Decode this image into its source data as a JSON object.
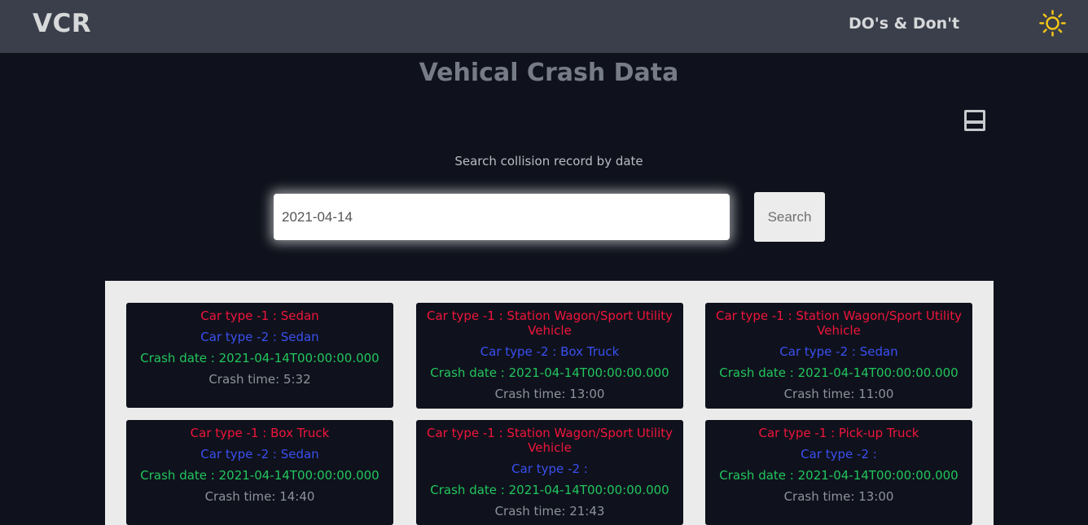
{
  "navbar": {
    "brand": "VCR",
    "link": "DO's & Don't",
    "theme_icon": "sun-icon"
  },
  "main": {
    "title": "Vehical Crash Data",
    "save_icon": "save-icon",
    "search_label": "Search collision record by date",
    "search_value": "2021-04-14",
    "search_button": "Search"
  },
  "colors": {
    "type1": "#f0143c",
    "type2": "#3a4ff0",
    "date": "#22c55e",
    "time": "#8e929a",
    "theme_icon": "#f5c518"
  },
  "records": [
    {
      "type1": "Car type -1 : Sedan",
      "type2": "Car type -2 : Sedan",
      "date": "Crash date : 2021-04-14T00:00:00.000",
      "time": "Crash time: 5:32"
    },
    {
      "type1": "Car type -1 : Station Wagon/Sport Utility Vehicle",
      "type2": "Car type -2 : Box Truck",
      "date": "Crash date : 2021-04-14T00:00:00.000",
      "time": "Crash time: 13:00"
    },
    {
      "type1": "Car type -1 : Station Wagon/Sport Utility Vehicle",
      "type2": "Car type -2 : Sedan",
      "date": "Crash date : 2021-04-14T00:00:00.000",
      "time": "Crash time: 11:00"
    },
    {
      "type1": "Car type -1 : Box Truck",
      "type2": "Car type -2 : Sedan",
      "date": "Crash date : 2021-04-14T00:00:00.000",
      "time": "Crash time: 14:40"
    },
    {
      "type1": "Car type -1 : Station Wagon/Sport Utility Vehicle",
      "type2": "Car type -2 :",
      "date": "Crash date : 2021-04-14T00:00:00.000",
      "time": "Crash time: 21:43"
    },
    {
      "type1": "Car type -1 : Pick-up Truck",
      "type2": "Car type -2 :",
      "date": "Crash date : 2021-04-14T00:00:00.000",
      "time": "Crash time: 13:00"
    }
  ]
}
